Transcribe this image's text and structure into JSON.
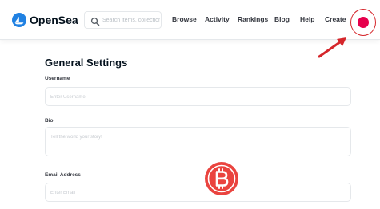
{
  "header": {
    "brand": "OpenSea",
    "search": {
      "placeholder": "Search items, collections"
    },
    "nav": {
      "browse": "Browse",
      "activity": "Activity",
      "rankings": "Rankings",
      "blog": "Blog",
      "help": "Help",
      "create": "Create"
    }
  },
  "settings": {
    "title": "General Settings",
    "username": {
      "label": "Username",
      "placeholder": "Enter Username"
    },
    "bio": {
      "label": "Bio",
      "placeholder": "Tell the world your story!"
    },
    "email": {
      "label": "Email Address",
      "placeholder": "Enter Email"
    }
  },
  "icons": {
    "logo": "opensea-logo-icon",
    "search": "search-icon",
    "avatar": "avatar",
    "annotation": "red-arrow-annotation",
    "watermark": "bitcoin-watermark-icon"
  },
  "colors": {
    "brand_blue": "#2081e2",
    "avatar_pink": "#e6004c",
    "annotation_red": "#d5262b",
    "watermark_red": "#e8302a"
  }
}
